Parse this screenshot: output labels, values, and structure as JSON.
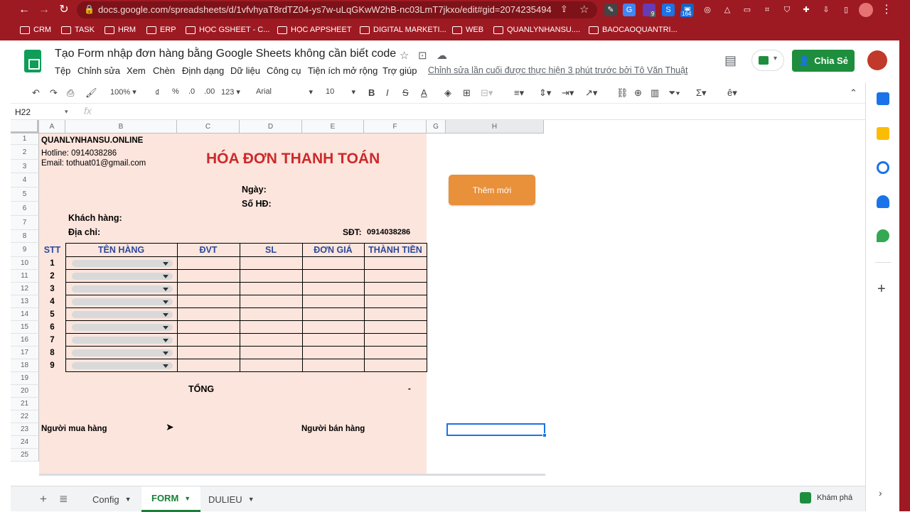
{
  "browser": {
    "url": "docs.google.com/spreadsheets/d/1vfvhyaT8rdTZ04-ys7w-uLqGKwW2hB-nc03LmT7jkxo/edit#gid=2074235494",
    "ext_badge_1": "9",
    "ext_badge_2": "164"
  },
  "bookmarks": [
    "CRM",
    "TASK",
    "HRM",
    "ERP",
    "HỌC GSHEET - C...",
    "HỌC APPSHEET",
    "DIGITAL MARKETI...",
    "WEB",
    "QUANLYNHANSU....",
    "BAOCAOQUANTRI..."
  ],
  "doc": {
    "title": "Tạo Form nhập đơn hàng bằng Google Sheets không cần biết code",
    "last_edit": "Chỉnh sửa lần cuối được thực hiện 3 phút trước bởi Tô Văn Thuật",
    "share_label": "Chia Sẻ"
  },
  "menus": [
    "Tệp",
    "Chỉnh sửa",
    "Xem",
    "Chèn",
    "Định dạng",
    "Dữ liệu",
    "Công cụ",
    "Tiện ích mở rộng",
    "Trợ giúp"
  ],
  "toolbar": {
    "zoom": "100%",
    "currency": "₫",
    "percent": "%",
    "dec_less": ".0",
    "dec_more": ".00",
    "format": "123",
    "font": "Arial",
    "size": "10"
  },
  "formula": {
    "namebox": "H22",
    "fx": "fx"
  },
  "columns": [
    "A",
    "B",
    "C",
    "D",
    "E",
    "F",
    "G",
    "H"
  ],
  "rows": [
    "1",
    "2",
    "3",
    "4",
    "5",
    "6",
    "7",
    "8",
    "9",
    "10",
    "11",
    "12",
    "13",
    "14",
    "15",
    "16",
    "17",
    "18",
    "19",
    "20",
    "21",
    "22",
    "23",
    "24",
    "25"
  ],
  "invoice": {
    "company": "QUANLYNHANSU.ONLINE",
    "hotline": "Hotline: 0914038286",
    "email": "Email: tothuat01@gmail.com",
    "title": "HÓA ĐƠN THANH TOÁN",
    "date_label": "Ngày:",
    "number_label": "Số HĐ:",
    "customer_label": "Khách hàng:",
    "address_label": "Địa chỉ:",
    "phone_label": "SĐT:",
    "phone_value": "0914038286",
    "headers": [
      "STT",
      "TÊN HÀNG",
      "ĐVT",
      "SL",
      "ĐƠN GIÁ",
      "THÀNH TIỀN"
    ],
    "items": [
      "1",
      "2",
      "3",
      "4",
      "5",
      "6",
      "7",
      "8",
      "9"
    ],
    "total_label": "TỔNG",
    "total_value": "-",
    "buyer": "Người mua hàng",
    "seller": "Người bán hàng"
  },
  "add_button": "Thêm mới",
  "tabs": [
    "Config",
    "FORM",
    "DULIEU"
  ],
  "explore": "Khám phá"
}
